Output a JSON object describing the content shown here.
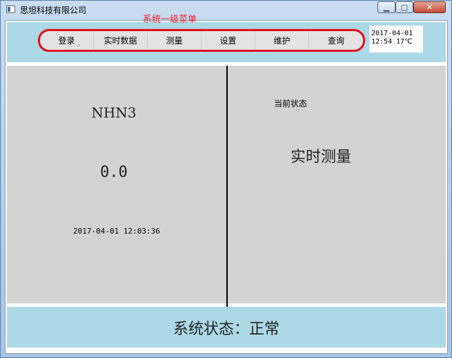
{
  "window": {
    "title": "思坦科技有限公司",
    "minimize_glyph": "▁",
    "maximize_glyph": "□",
    "close_glyph": "✕"
  },
  "menu": {
    "annotation": "系统一级菜单",
    "items": [
      {
        "label": "登录"
      },
      {
        "label": "实时数据"
      },
      {
        "label": "测量"
      },
      {
        "label": "设置"
      },
      {
        "label": "维护"
      },
      {
        "label": "查询"
      }
    ],
    "border_color": "#e30c1a"
  },
  "clock": {
    "date": "2017-04-01",
    "time_temp": "12:54 17℃"
  },
  "reading": {
    "gas": "NHN3",
    "value": "0.0",
    "timestamp": "2017-04-01 12:03:36"
  },
  "state": {
    "label": "当前状态",
    "value": "实时测量"
  },
  "status": {
    "label": "系统状态：",
    "value": "正常"
  },
  "colors": {
    "panel_bg": "#d3d3d3",
    "bar_bg": "#add8e6",
    "annotation_red": "#e8202a"
  },
  "icons": {
    "app": "app-icon",
    "minimize": "minimize-icon",
    "maximize": "maximize-icon",
    "close": "close-icon"
  }
}
